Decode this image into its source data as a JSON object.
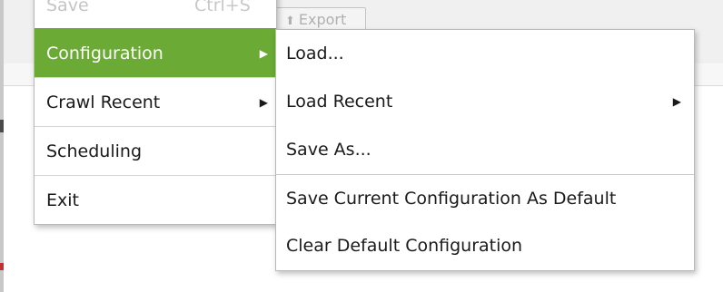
{
  "background": {
    "export_button_label": "Export"
  },
  "main_menu": {
    "items": [
      {
        "label": "Save",
        "shortcut": "Ctrl+S"
      },
      {
        "label": "Configuration",
        "has_submenu": true,
        "active": true
      },
      {
        "label": "Crawl Recent",
        "has_submenu": true
      },
      {
        "label": "Scheduling"
      },
      {
        "label": "Exit"
      }
    ]
  },
  "submenu": {
    "items": [
      {
        "label": "Load..."
      },
      {
        "label": "Load Recent",
        "has_submenu": true
      },
      {
        "label": "Save As..."
      },
      {
        "label": "Save Current Configuration As Default"
      },
      {
        "label": "Clear Default Configuration"
      }
    ]
  },
  "icons": {
    "submenu_arrow": "right-triangle-icon",
    "export": "up-arrow-icon"
  },
  "colors": {
    "active_highlight": "#6aaa35",
    "menu_border": "#b9b9b9"
  }
}
